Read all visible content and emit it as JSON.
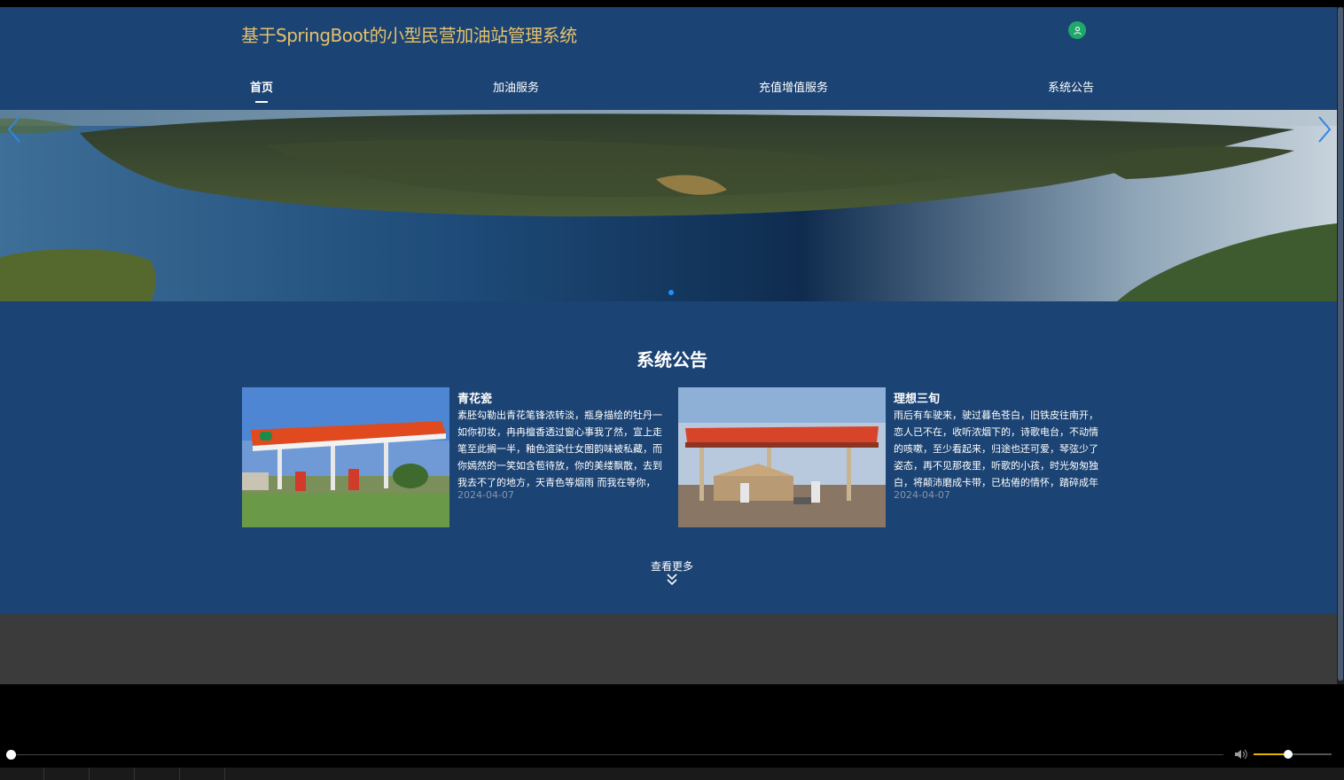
{
  "header": {
    "site_title": "基于SpringBoot的小型民营加油站管理系统",
    "avatar_icon": "user-icon",
    "avatar_color": "#1fa86a",
    "title_color": "#e5c16b",
    "background": "#1b4373"
  },
  "nav": {
    "items": [
      {
        "label": "首页",
        "active": true
      },
      {
        "label": "加油服务",
        "active": false
      },
      {
        "label": "充值增值服务",
        "active": false
      },
      {
        "label": "系统公告",
        "active": false
      }
    ]
  },
  "banner": {
    "prev_icon": "chevron-left-icon",
    "next_icon": "chevron-right-icon",
    "slide_count": 1,
    "active_slide": 1
  },
  "announcements": {
    "title": "系统公告",
    "items": [
      {
        "title": "青花瓷",
        "text": "素胚勾勒出青花笔锋浓转淡，瓶身描绘的牡丹一如你初妆，冉冉檀香透过窗心事我了然，宣上走笔至此搁一半，釉色渲染仕女图韵味被私藏，而你嫣然的一笑如含苞待放，你的美缕飘散，去到我去不了的地方，天青色等烟雨 而我在等你，",
        "date": "2024-04-07",
        "image_icon": "gas-station-photo"
      },
      {
        "title": "理想三旬",
        "text": "雨后有车驶来，驶过暮色苍白，旧铁皮往南开，恋人已不在，收听浓烟下的，诗歌电台，不动情的咳嗽，至少看起来，归途也还可爱，琴弦少了姿态，再不见那夜里，听歌的小孩，时光匆匆独白，将颠沛磨成卡带，已枯倦的情怀，踏碎成年",
        "date": "2024-04-07",
        "image_icon": "gas-station-photo"
      }
    ],
    "more_label": "查看更多",
    "more_icon": "double-chevron-down-icon"
  },
  "player": {
    "progress": 0.0,
    "volume": 0.45,
    "volume_icon": "speaker-icon",
    "volume_color": "#e5b400"
  }
}
